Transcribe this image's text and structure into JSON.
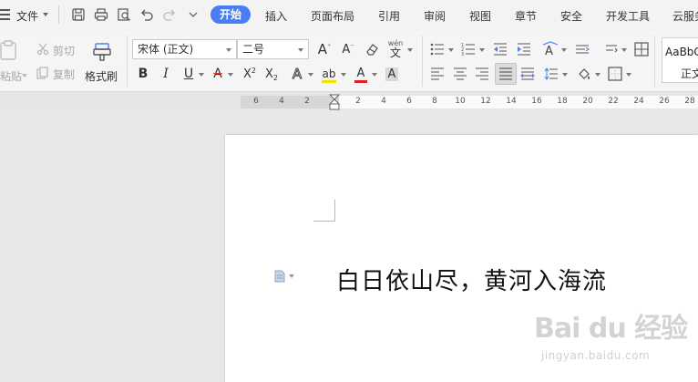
{
  "menubar": {
    "file_label": "文件",
    "tabs": [
      {
        "label": "开始",
        "active": true
      },
      {
        "label": "插入"
      },
      {
        "label": "页面布局"
      },
      {
        "label": "引用"
      },
      {
        "label": "审阅"
      },
      {
        "label": "视图"
      },
      {
        "label": "章节"
      },
      {
        "label": "安全"
      },
      {
        "label": "开发工具"
      },
      {
        "label": "云服务"
      }
    ],
    "quick_access_icons": [
      "save-icon",
      "print-icon",
      "print-preview-icon",
      "undo-icon",
      "redo-icon",
      "customize-dropdown-icon"
    ],
    "accent_color": "#4a7ef0"
  },
  "toolbar": {
    "paste_label": "粘贴",
    "cut_label": "剪切",
    "copy_label": "复制",
    "format_painter_label": "格式刷",
    "font_name": "宋体 (正文)",
    "font_size": "二号",
    "style_preview_text": "AaBbC",
    "style_name": "正文",
    "grow_font_label": "A",
    "shrink_font_label": "A",
    "bold_label": "B",
    "italic_label": "I",
    "underline_label": "U",
    "strike_label": "A",
    "superscript_label": "X",
    "subscript_label": "X",
    "text_effect_label": "A",
    "highlight_label": "ab",
    "font_color_label": "A",
    "char_shading_label": "A",
    "phonetic_label": "wén",
    "icons": [
      "paste-icon",
      "scissors-icon",
      "copy-icon",
      "format-painter-icon",
      "clear-format-icon",
      "bullet-list-icon",
      "numbered-list-icon",
      "decrease-indent-icon",
      "increase-indent-icon",
      "text-direction-icon",
      "line-spacing-icon",
      "table-icon",
      "align-left-icon",
      "align-center-icon",
      "align-right-icon",
      "justify-icon",
      "distributed-icon",
      "paragraph-spacing-icon",
      "fill-icon",
      "border-icon"
    ]
  },
  "ruler": {
    "numbers": [
      "6",
      "4",
      "2",
      "2",
      "4",
      "6",
      "8",
      "10",
      "12",
      "14",
      "16",
      "18",
      "20",
      "22",
      "24",
      "26",
      "28"
    ]
  },
  "document": {
    "text": "白日依山尽，黄河入海流"
  },
  "watermark": {
    "logo": "Bai du 经验",
    "sub": "jingyan.baidu.com"
  }
}
